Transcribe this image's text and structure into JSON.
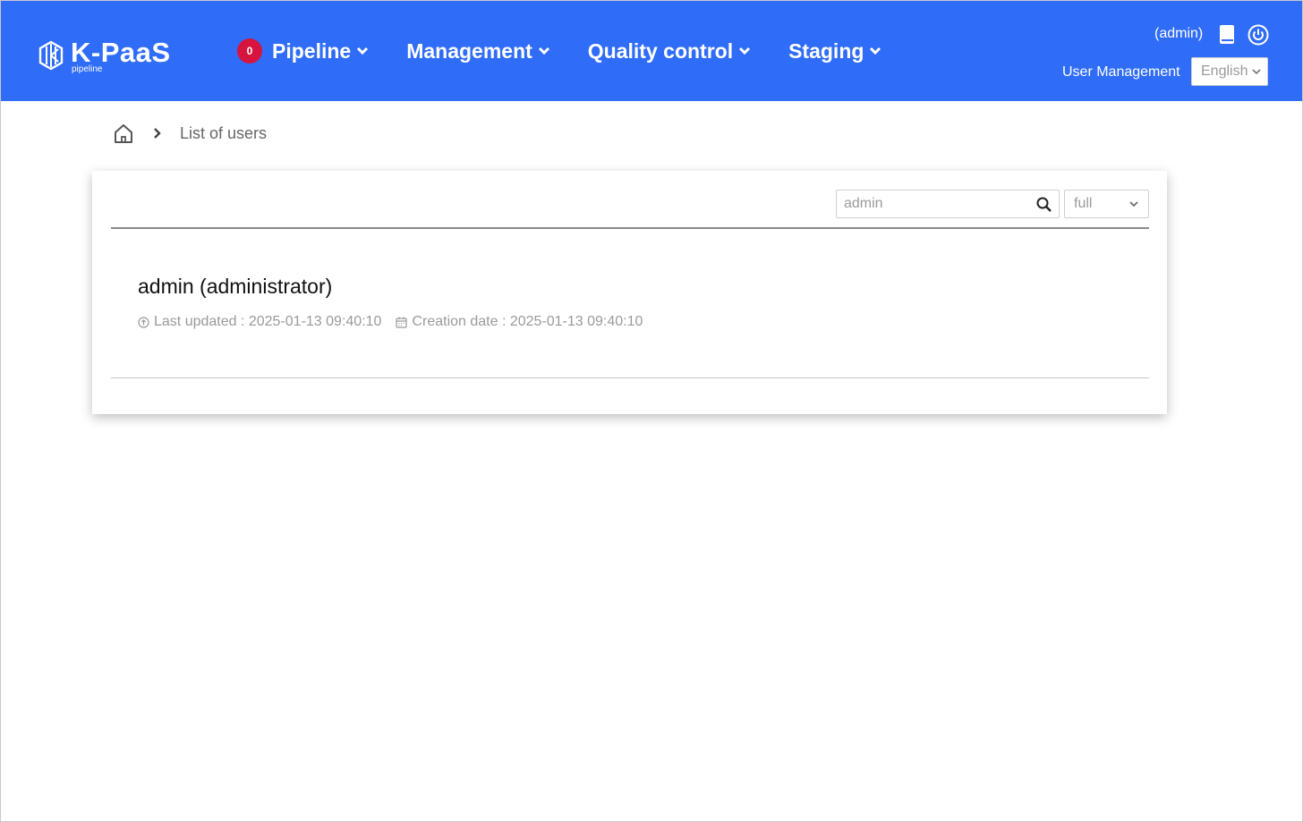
{
  "app": {
    "logo_title": "K-PaaS",
    "logo_subtitle": "pipeline"
  },
  "nav": {
    "badge_count": "0",
    "items": [
      {
        "label": "Pipeline"
      },
      {
        "label": "Management"
      },
      {
        "label": "Quality control"
      },
      {
        "label": "Staging"
      }
    ]
  },
  "header_right": {
    "user": "(admin)",
    "user_management": "User Management",
    "language": "English"
  },
  "breadcrumb": {
    "current": "List of users"
  },
  "search": {
    "value": "admin",
    "filter_value": "full"
  },
  "user_entry": {
    "title": "admin (administrator)",
    "last_updated": "Last updated : 2025-01-13 09:40:10",
    "creation_date": "Creation date : 2025-01-13 09:40:10"
  },
  "colors": {
    "header_bg": "#2f6cf8",
    "badge_bg": "#d6143e"
  }
}
